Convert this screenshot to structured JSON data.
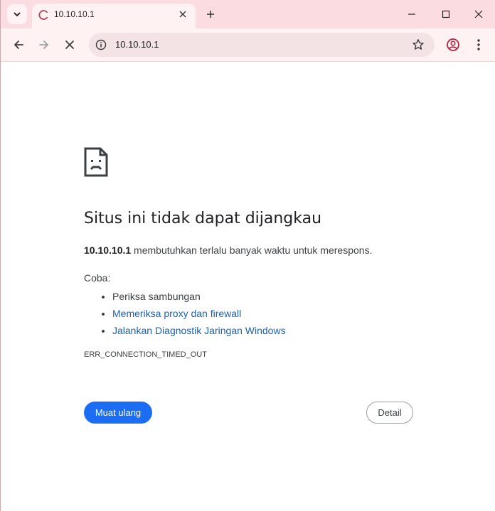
{
  "browser": {
    "tab": {
      "title": "10.10.10.1",
      "close_glyph": "✕"
    },
    "new_tab_glyph": "+",
    "tab_search_glyph": "⌄",
    "window_controls": {
      "minimize": "—",
      "maximize": "☐",
      "close": "✕"
    },
    "omnibox": {
      "url": "10.10.10.1"
    },
    "accent_color": "#fbdde1"
  },
  "error_page": {
    "title": "Situs ini tidak dapat dijangkau",
    "summary_host": "10.10.10.1",
    "summary_rest": " membutuhkan terlalu banyak waktu untuk merespons.",
    "try_label": "Coba:",
    "suggestions": [
      {
        "text": "Periksa sambungan",
        "is_link": false
      },
      {
        "text": "Memeriksa proxy dan firewall",
        "is_link": true
      },
      {
        "text": "Jalankan Diagnostik Jaringan Windows",
        "is_link": true
      }
    ],
    "error_code": "ERR_CONNECTION_TIMED_OUT",
    "reload_label": "Muat ulang",
    "details_label": "Detail",
    "primary_color": "#1b6ef3",
    "link_color": "#1a62b3"
  },
  "icons": {
    "tab_search": "chevron-down-icon",
    "loading": "loading-spinner-icon",
    "back": "back-arrow-icon",
    "forward": "forward-arrow-icon",
    "stop": "stop-icon",
    "site_info": "info-icon",
    "bookmark": "star-icon",
    "profile": "profile-icon",
    "menu": "kebab-menu-icon",
    "sad_page": "sad-page-icon"
  }
}
